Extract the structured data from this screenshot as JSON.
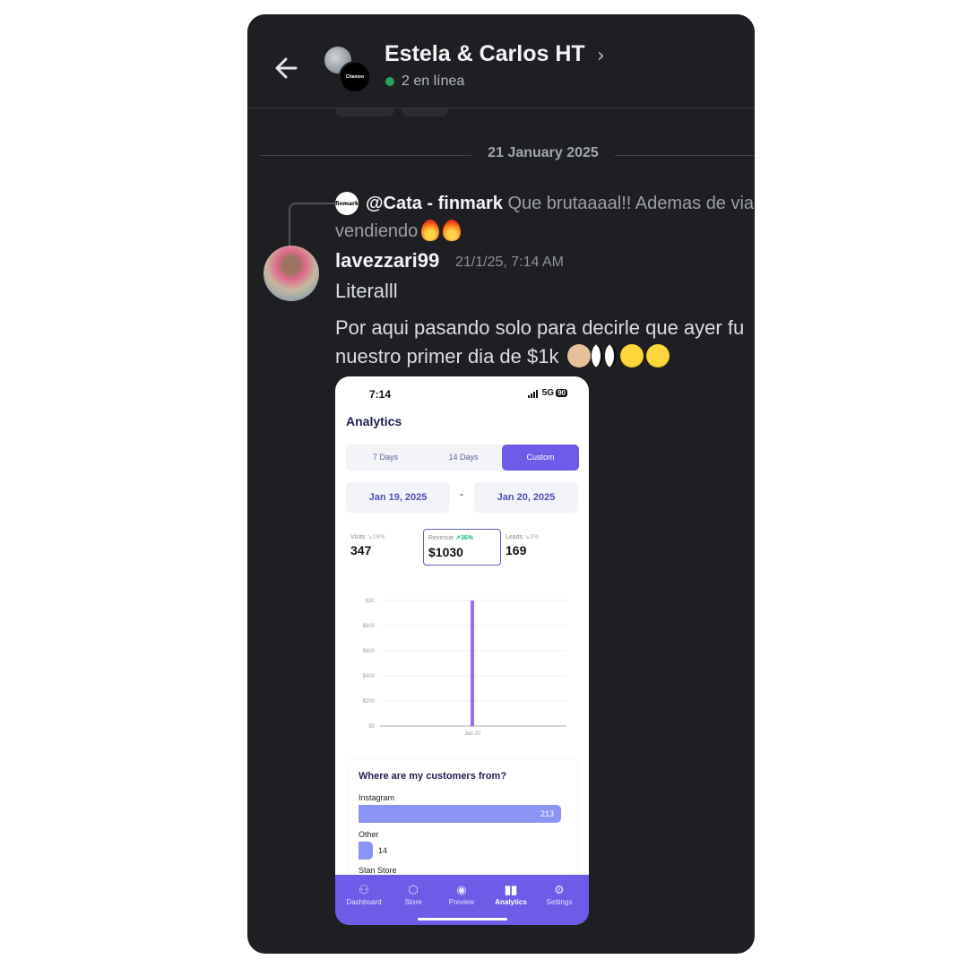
{
  "header": {
    "title": "Estela & Carlos HT",
    "chevron": "›",
    "status": "2 en línea",
    "avatar_b_text": "Chamoo",
    "status_color": "#23a55a"
  },
  "divider": {
    "date": "21 January 2025"
  },
  "reply": {
    "avatar_text": "finmark",
    "author": "@Cata - finmark",
    "text": "Que brutaaaal!! Ademas de via",
    "continuation": "vendiendo"
  },
  "message": {
    "username": "lavezzari99",
    "timestamp": "21/1/25, 7:14 AM",
    "line1": "Literalll",
    "line2a": "Por aqui pasando solo para decirle que ayer fu",
    "line2b": "nuestro primer dia de $1k"
  },
  "phone": {
    "time": "7:14",
    "network": "5G",
    "battery": "90",
    "title": "Analytics",
    "tabs": [
      "7 Days",
      "14 Days",
      "Custom"
    ],
    "active_tab": "Custom",
    "date_from": "Jan 19, 2025",
    "date_sep": "-",
    "date_to": "Jan 20, 2025",
    "stats": {
      "visits_label": "Visits",
      "visits_change": "↘19%",
      "visits": "347",
      "revenue_label": "Revenue",
      "revenue_change": "↗36%",
      "revenue": "$1030",
      "leads_label": "Leads",
      "leads_change": "↘3%",
      "leads": "169"
    },
    "accent": "#6c5ce7",
    "customers": {
      "title": "Where are my customers from?",
      "items": [
        {
          "label": "Instagram",
          "value": "213"
        },
        {
          "label": "Other",
          "value": "14"
        },
        {
          "label": "Stan Store",
          "value": ""
        }
      ]
    },
    "nav": [
      {
        "label": "Dashboard",
        "icon": "dashboard-icon"
      },
      {
        "label": "Store",
        "icon": "store-icon"
      },
      {
        "label": "Preview",
        "icon": "eye-icon"
      },
      {
        "label": "Analytics",
        "icon": "bar-chart-icon"
      },
      {
        "label": "Settings",
        "icon": "gear-icon"
      }
    ]
  },
  "chart_data": {
    "type": "bar",
    "categories": [
      "Jan 20"
    ],
    "values": [
      1000
    ],
    "y_ticks": [
      "$0",
      "$200",
      "$400",
      "$600",
      "$800",
      "$1K"
    ],
    "ylim": [
      0,
      1000
    ],
    "grid": true,
    "color": "#9b6cf0"
  }
}
